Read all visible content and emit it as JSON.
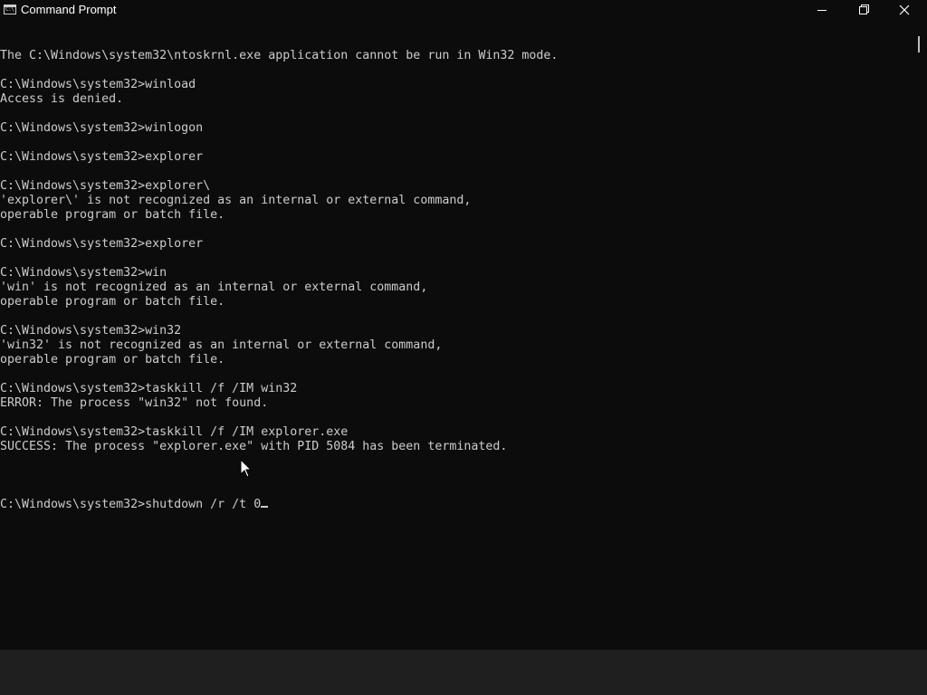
{
  "window": {
    "title": "Command Prompt",
    "icon_label": "C:\\",
    "buttons": [
      "minimize-icon",
      "maximize-icon",
      "close-icon"
    ]
  },
  "console": {
    "lines": [
      "The C:\\Windows\\system32\\ntoskrnl.exe application cannot be run in Win32 mode.",
      "",
      "C:\\Windows\\system32>winload",
      "Access is denied.",
      "",
      "C:\\Windows\\system32>winlogon",
      "",
      "C:\\Windows\\system32>explorer",
      "",
      "C:\\Windows\\system32>explorer\\",
      "'explorer\\' is not recognized as an internal or external command,",
      "operable program or batch file.",
      "",
      "C:\\Windows\\system32>explorer",
      "",
      "C:\\Windows\\system32>win",
      "'win' is not recognized as an internal or external command,",
      "operable program or batch file.",
      "",
      "C:\\Windows\\system32>win32",
      "'win32' is not recognized as an internal or external command,",
      "operable program or batch file.",
      "",
      "C:\\Windows\\system32>taskkill /f /IM win32",
      "ERROR: The process \"win32\" not found.",
      "",
      "C:\\Windows\\system32>taskkill /f /IM explorer.exe",
      "SUCCESS: The process \"explorer.exe\" with PID 5084 has been terminated.",
      ""
    ],
    "prompt": "C:\\Windows\\system32>",
    "current_input": "shutdown /r /t 0"
  },
  "colors": {
    "background": "#0c0c0c",
    "text": "#cccccc",
    "title_text": "#ffffff",
    "bottom_strip": "#1f1f1f"
  }
}
